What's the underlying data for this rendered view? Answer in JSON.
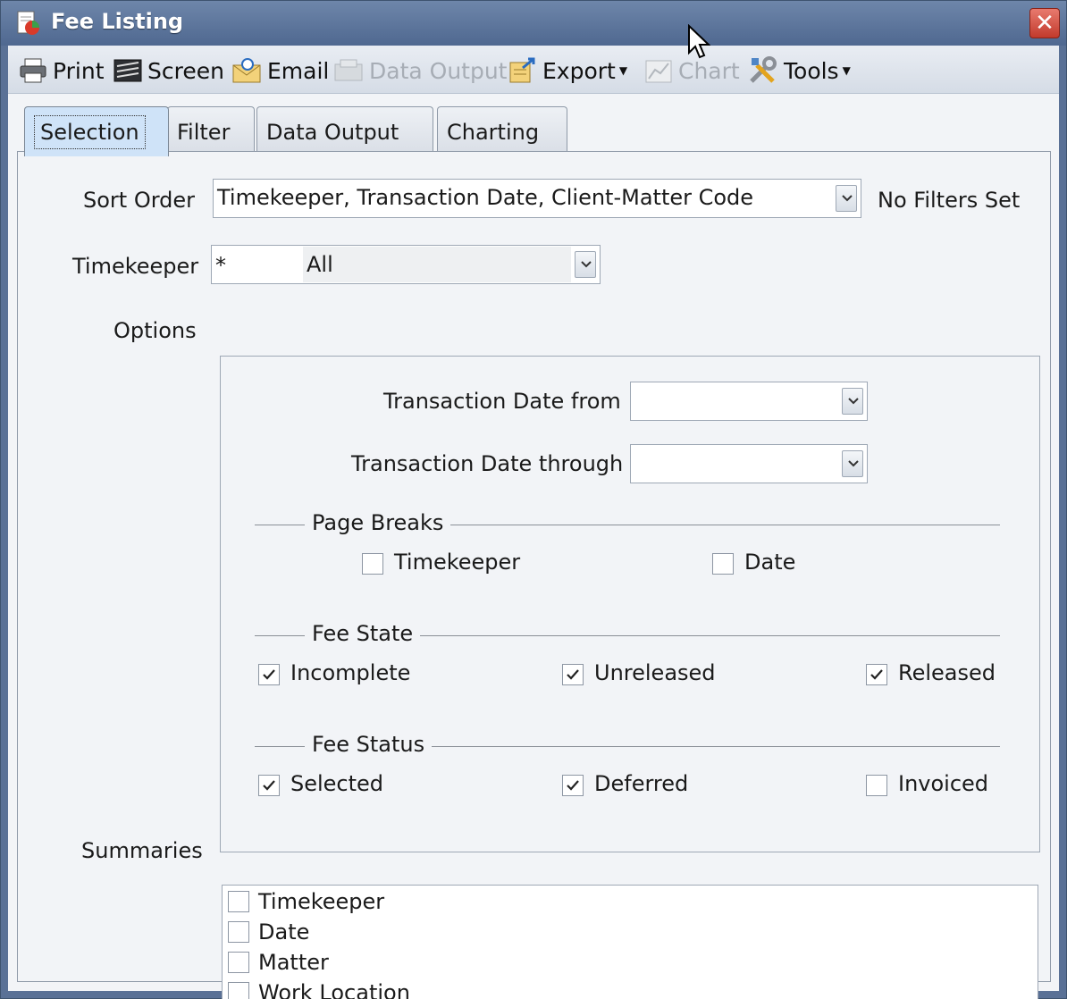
{
  "window": {
    "title": "Fee Listing"
  },
  "toolbar": {
    "print": "Print",
    "screen": "Screen",
    "email": "Email",
    "data_output": "Data Output",
    "export": "Export",
    "chart": "Chart",
    "tools": "Tools"
  },
  "tabs": [
    {
      "label": "Selection",
      "active": true
    },
    {
      "label": "Filter"
    },
    {
      "label": "Data Output"
    },
    {
      "label": "Charting"
    }
  ],
  "sort_order": {
    "label": "Sort Order",
    "value": "Timekeeper, Transaction Date, Client-Matter Code"
  },
  "filters_status": "No Filters Set",
  "timekeeper": {
    "label": "Timekeeper",
    "code": "*",
    "name": "All"
  },
  "options": {
    "label": "Options",
    "date_from_label": "Transaction Date from",
    "date_from_value": "",
    "date_through_label": "Transaction Date through",
    "date_through_value": "",
    "page_breaks": {
      "title": "Page Breaks",
      "items": [
        {
          "label": "Timekeeper",
          "checked": false
        },
        {
          "label": "Date",
          "checked": false
        }
      ]
    },
    "fee_state": {
      "title": "Fee State",
      "items": [
        {
          "label": "Incomplete",
          "checked": true
        },
        {
          "label": "Unreleased",
          "checked": true
        },
        {
          "label": "Released",
          "checked": true
        }
      ]
    },
    "fee_status": {
      "title": "Fee Status",
      "items": [
        {
          "label": "Selected",
          "checked": true
        },
        {
          "label": "Deferred",
          "checked": true
        },
        {
          "label": "Invoiced",
          "checked": false
        }
      ]
    }
  },
  "summaries": {
    "label": "Summaries",
    "items": [
      {
        "label": "Timekeeper",
        "checked": false
      },
      {
        "label": "Date",
        "checked": false
      },
      {
        "label": "Matter",
        "checked": false
      },
      {
        "label": "Work Location",
        "checked": false
      }
    ]
  }
}
